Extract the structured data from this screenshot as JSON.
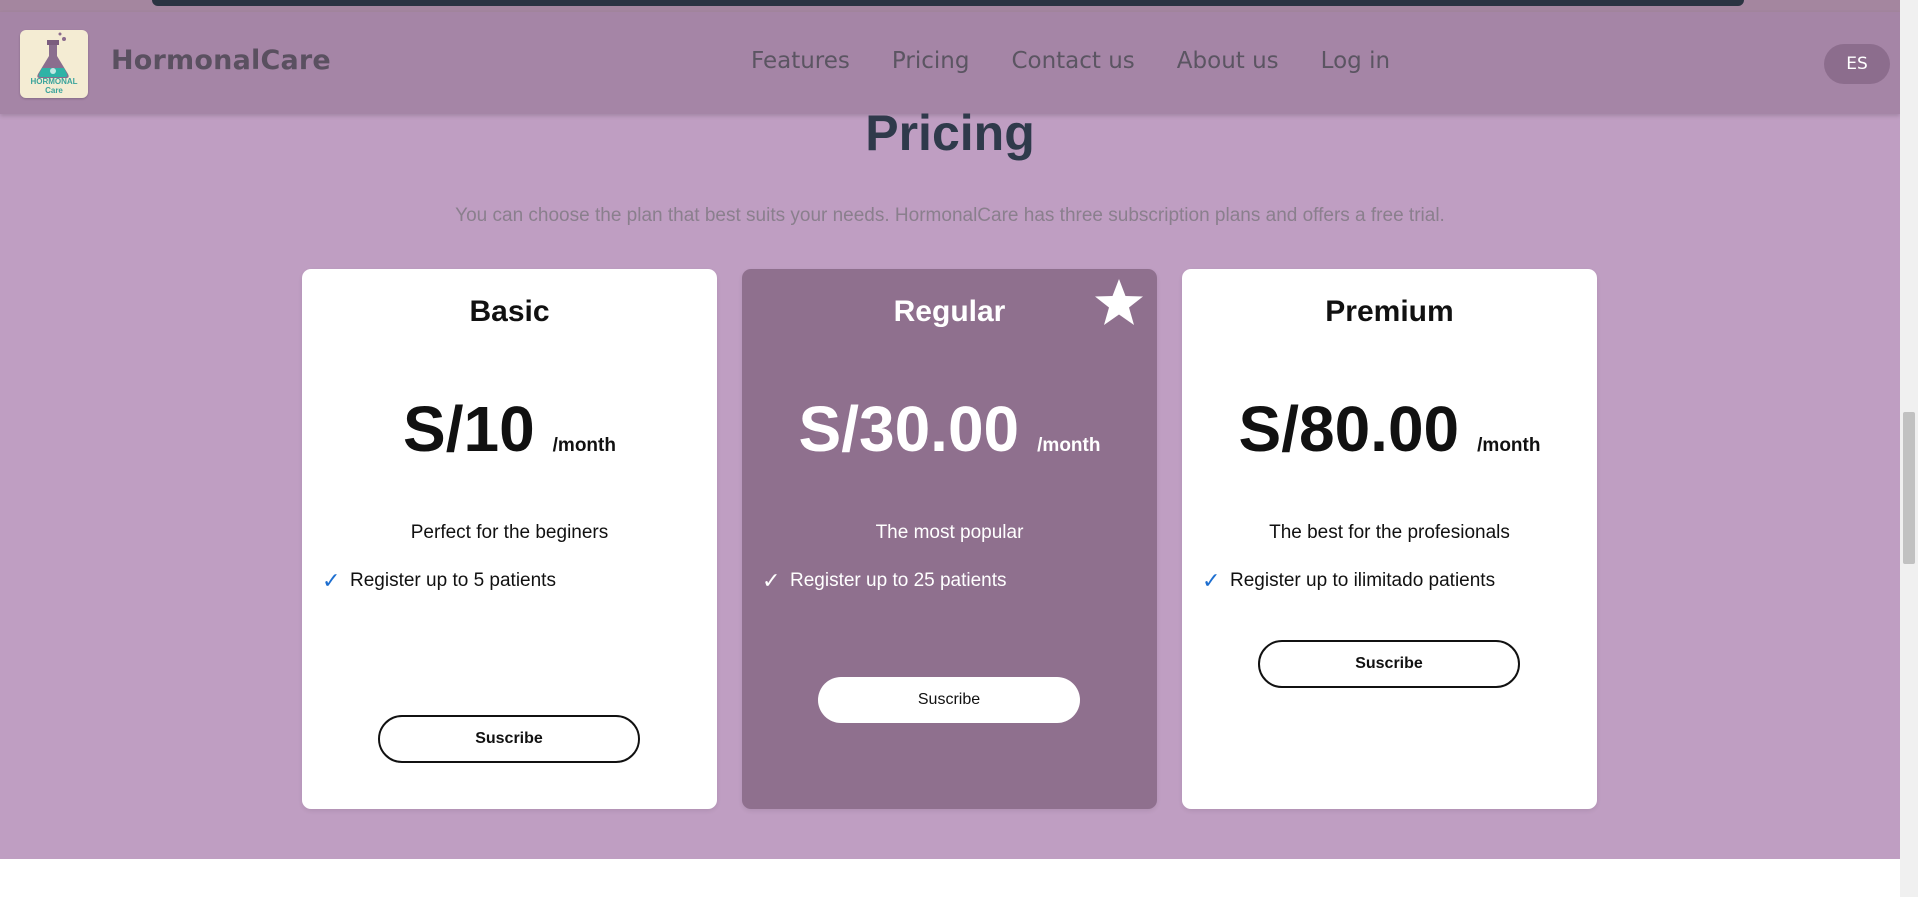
{
  "header": {
    "brand": "HormonalCare",
    "logo_text": "HORMONAL Care",
    "nav": [
      {
        "label": "Features"
      },
      {
        "label": "Pricing"
      },
      {
        "label": "Contact us"
      },
      {
        "label": "About us"
      },
      {
        "label": "Log in"
      }
    ],
    "language_button": "ES"
  },
  "pricing": {
    "title": "Pricing",
    "subtitle": "You can choose the plan that best suits your needs. HormonalCare has three subscription plans and offers a free trial.",
    "plans": [
      {
        "name": "Basic",
        "price": "S/10",
        "period": "/month",
        "description": "Perfect for the beginers",
        "feature": "Register up to 5 patients",
        "button": "Suscribe",
        "featured": false
      },
      {
        "name": "Regular",
        "price": "S/30.00",
        "period": "/month",
        "description": "The most popular",
        "feature": "Register up to 25 patients",
        "button": "Suscribe",
        "featured": true
      },
      {
        "name": "Premium",
        "price": "S/80.00",
        "period": "/month",
        "description": "The best for the profesionals",
        "feature": "Register up to ilimitado patients",
        "button": "Suscribe",
        "featured": false
      }
    ],
    "check_glyph": "✓"
  },
  "colors": {
    "page_bg": "#bf9ec2",
    "navbar_bg": "#a585a6",
    "featured_card_bg": "#8f708e",
    "title_color": "#2f3a4b",
    "check_color": "#1e6fd0"
  },
  "icons": {
    "logo": "flask-logo-icon",
    "featured": "star-icon",
    "feature_check": "check-icon"
  }
}
